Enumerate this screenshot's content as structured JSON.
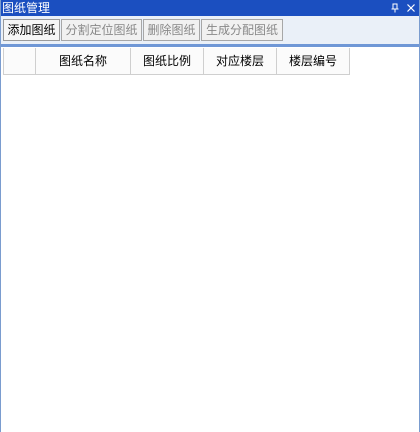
{
  "panel": {
    "title": "图纸管理"
  },
  "toolbar": {
    "add_label": "添加图纸",
    "split_label": "分割定位图纸",
    "delete_label": "删除图纸",
    "generate_label": "生成分配图纸"
  },
  "grid": {
    "columns": [
      "",
      "图纸名称",
      "图纸比例",
      "对应楼层",
      "楼层编号"
    ],
    "rows": []
  },
  "icons": {
    "pin": "pin-icon",
    "close": "close-icon"
  },
  "colors": {
    "titlebar": "#1b4fc0",
    "toolbar_bg": "#eaf0f8",
    "accent_border": "#6f97d6",
    "disabled_text": "#888888"
  }
}
